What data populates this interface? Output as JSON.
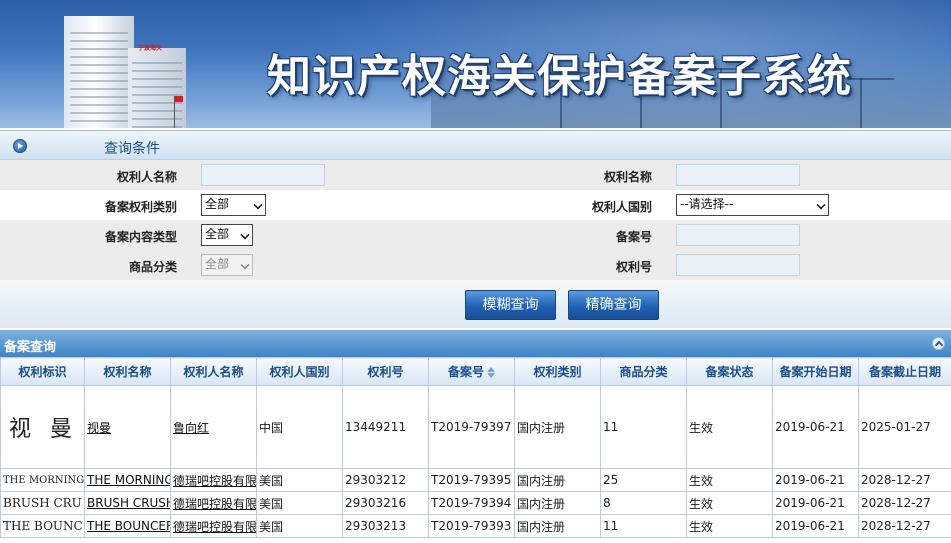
{
  "banner": {
    "title": "知识产权海关保护备案子系统",
    "building_sign": "宁波海关"
  },
  "query": {
    "section_title": "查询条件",
    "fields": {
      "rights_holder_name_label": "权利人名称",
      "right_name_label": "权利名称",
      "right_type_label": "备案权利类别",
      "right_type_value": "全部",
      "holder_country_label": "权利人国别",
      "holder_country_value": "--请选择--",
      "content_type_label": "备案内容类型",
      "content_type_value": "全部",
      "record_no_label": "备案号",
      "goods_class_label": "商品分类",
      "goods_class_value": "全部",
      "right_no_label": "权利号"
    },
    "buttons": {
      "fuzzy": "模糊查询",
      "exact": "精确查询"
    }
  },
  "results": {
    "section_title": "备案查询",
    "columns": [
      "权利标识",
      "权利名称",
      "权利人名称",
      "权利人国别",
      "权利号",
      "备案号",
      "权利类别",
      "商品分类",
      "备案状态",
      "备案开始日期",
      "备案截止日期"
    ],
    "rows": [
      {
        "mark": "视 曼",
        "name": "视曼",
        "holder": "鲁向红",
        "country": "中国",
        "right_no": "13449211",
        "record_no": "T2019-79397",
        "type": "国内注册",
        "goods": "11",
        "status": "生效",
        "start": "2019-06-21",
        "end": "2025-01-27"
      },
      {
        "mark": "THE MORNING AFTER",
        "name": "THE MORNING",
        "holder": "德瑞吧控股有限",
        "country": "美国",
        "right_no": "29303212",
        "record_no": "T2019-79395",
        "type": "国内注册",
        "goods": "25",
        "status": "生效",
        "start": "2019-06-21",
        "end": "2028-12-27"
      },
      {
        "mark": "BRUSH CRU",
        "name": "BRUSH CRUSH",
        "holder": "德瑞吧控股有限",
        "country": "美国",
        "right_no": "29303216",
        "record_no": "T2019-79394",
        "type": "国内注册",
        "goods": "8",
        "status": "生效",
        "start": "2019-06-21",
        "end": "2028-12-27"
      },
      {
        "mark": "THE BOUNC",
        "name": "THE BOUNCER",
        "holder": "德瑞吧控股有限",
        "country": "美国",
        "right_no": "29303213",
        "record_no": "T2019-79393",
        "type": "国内注册",
        "goods": "11",
        "status": "生效",
        "start": "2019-06-21",
        "end": "2028-12-27"
      }
    ]
  }
}
